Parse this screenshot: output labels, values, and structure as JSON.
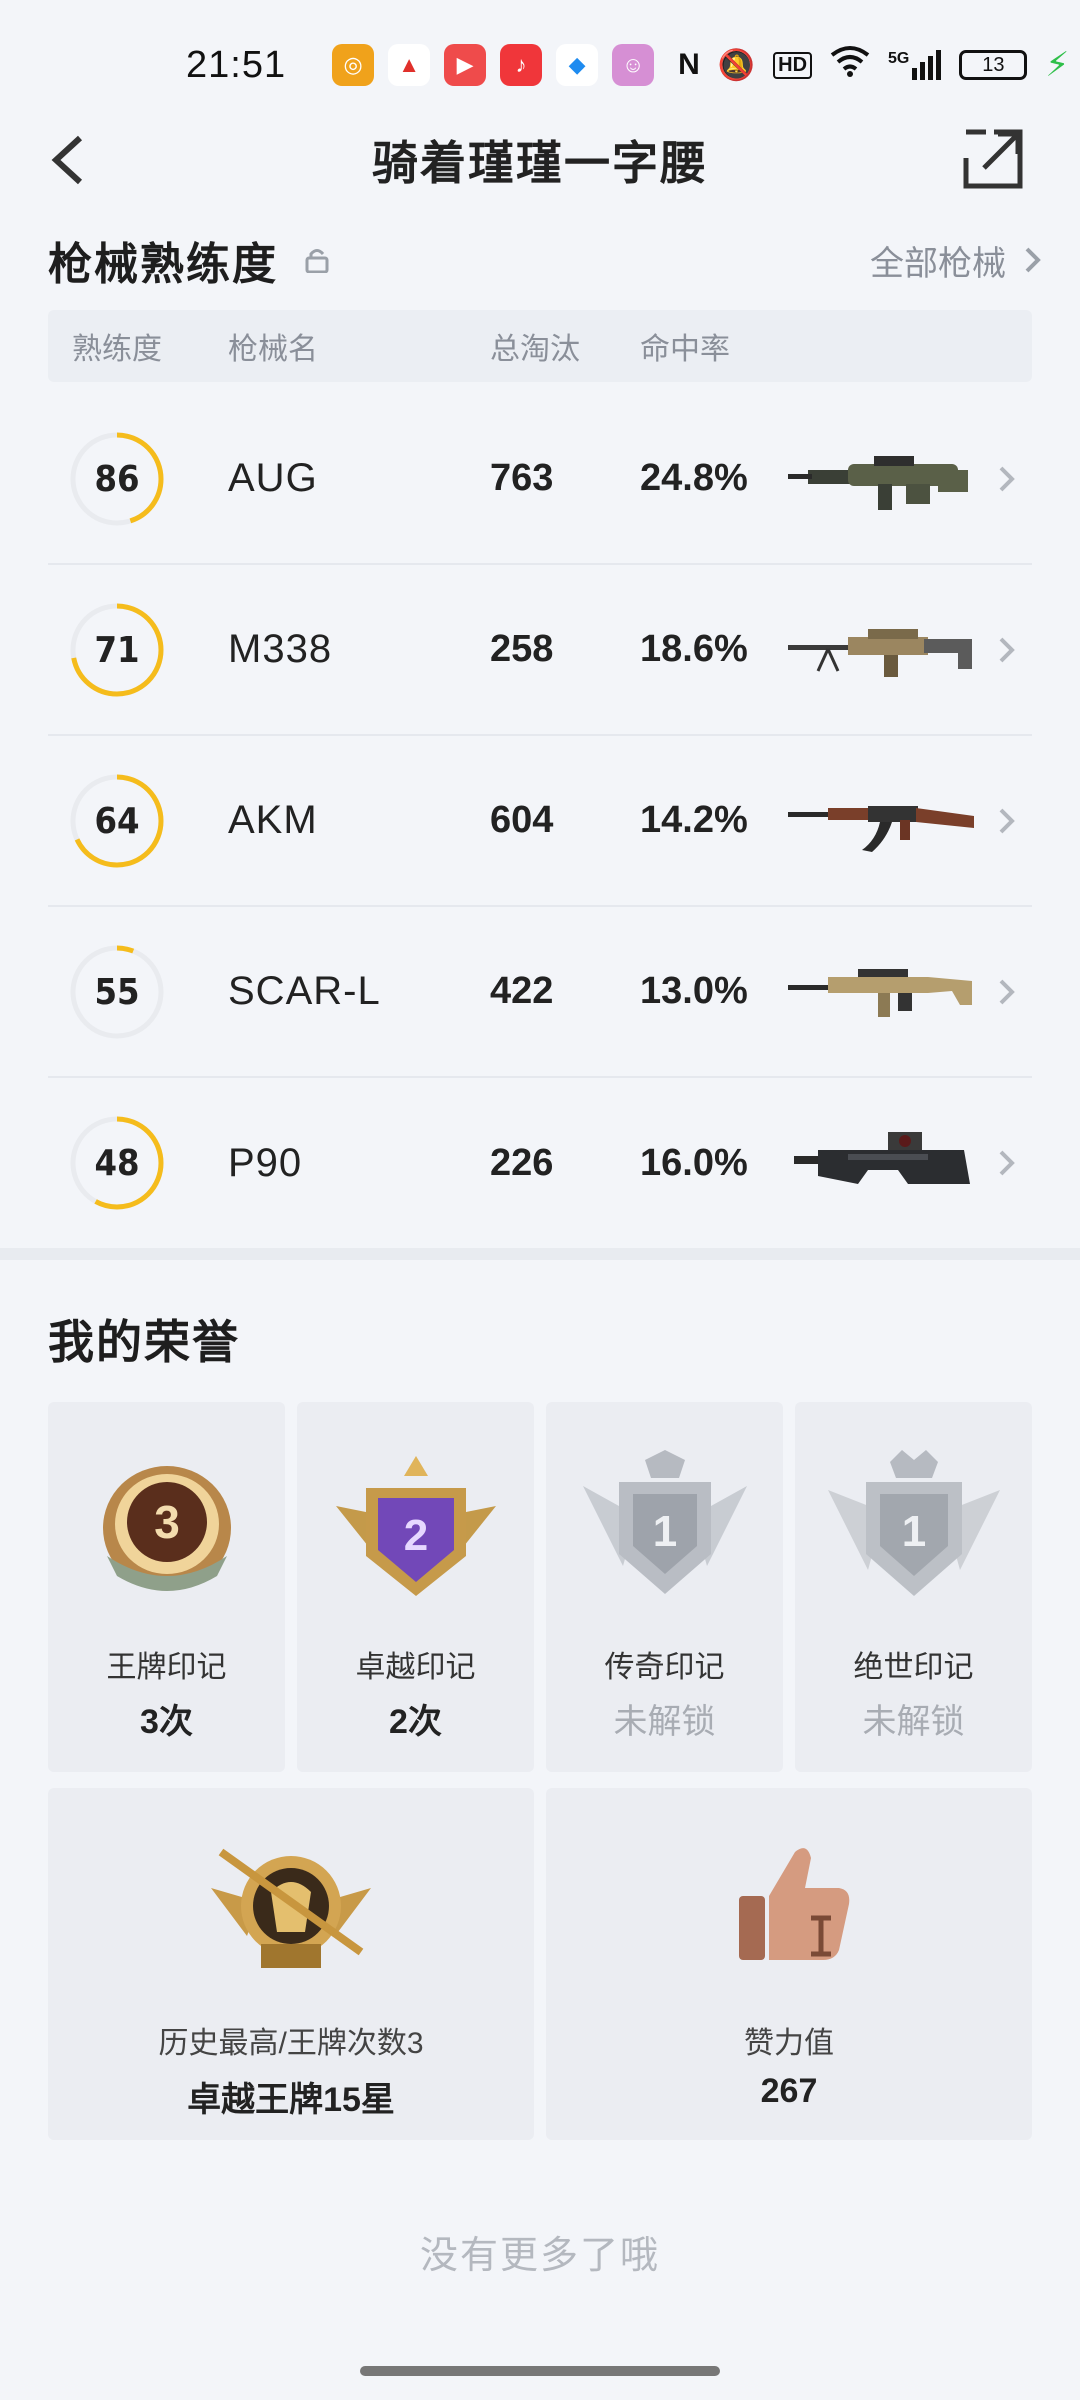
{
  "status_bar": {
    "time": "21:51",
    "network": "5G",
    "battery": "13",
    "hd": "HD",
    "nfc": "N"
  },
  "header": {
    "title": "骑着瑾瑾一字腰"
  },
  "weapons": {
    "title": "枪械熟练度",
    "all_link": "全部枪械",
    "columns": {
      "proficiency": "熟练度",
      "name": "枪械名",
      "kills": "总淘汰",
      "hit_rate": "命中率"
    },
    "rows": [
      {
        "proficiency": 86,
        "name": "AUG",
        "kills": "763",
        "hit_rate": "24.8%",
        "ring_fill": 0.45
      },
      {
        "proficiency": 71,
        "name": "M338",
        "kills": "258",
        "hit_rate": "18.6%",
        "ring_fill": 0.72
      },
      {
        "proficiency": 64,
        "name": "AKM",
        "kills": "604",
        "hit_rate": "14.2%",
        "ring_fill": 0.68
      },
      {
        "proficiency": 55,
        "name": "SCAR-L",
        "kills": "422",
        "hit_rate": "13.0%",
        "ring_fill": 0.06
      },
      {
        "proficiency": 48,
        "name": "P90",
        "kills": "226",
        "hit_rate": "16.0%",
        "ring_fill": 0.58
      }
    ],
    "ring_color": "#f5bc1c",
    "ring_track": "#e9ebef"
  },
  "honors": {
    "title": "我的荣誉",
    "badges": [
      {
        "label": "王牌印记",
        "value": "3次",
        "locked": false,
        "number": "3"
      },
      {
        "label": "卓越印记",
        "value": "2次",
        "locked": false,
        "number": "2"
      },
      {
        "label": "传奇印记",
        "value": "未解锁",
        "locked": true,
        "number": "1"
      },
      {
        "label": "绝世印记",
        "value": "未解锁",
        "locked": true,
        "number": "1"
      }
    ],
    "stats": [
      {
        "label": "历史最高/王牌次数3",
        "value": "卓越王牌15星"
      },
      {
        "label": "赞力值",
        "value": "267"
      }
    ]
  },
  "footer": {
    "no_more": "没有更多了哦"
  }
}
